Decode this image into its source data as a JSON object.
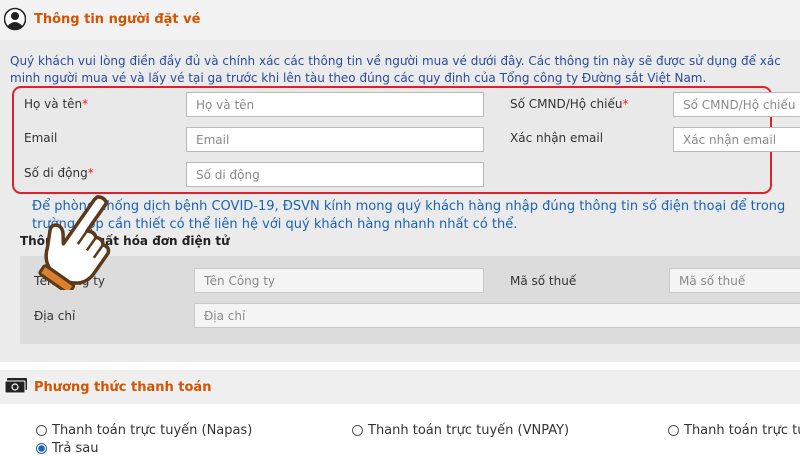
{
  "customer_section": {
    "title": "Thông tin người đặt vé",
    "intro": "Quý khách vui lòng điền đầy đủ và chính xác các thông tin về người mua vé dưới đây. Các thông tin này sẽ được sử dụng để xác minh người mua vé và lấy vé tại ga trước khi lên tàu theo đúng các quy định của Tổng công ty Đường sắt Việt Nam.",
    "fields": {
      "full_name": {
        "label": "Họ và tên",
        "required_mark": "*",
        "placeholder": "Họ và tên"
      },
      "id_number": {
        "label": "Số CMND/Hộ chiếu",
        "required_mark": "*",
        "placeholder": "Số CMND/Hộ chiếu"
      },
      "email": {
        "label": "Email",
        "placeholder": "Email"
      },
      "email_confirm": {
        "label": "Xác nhận email",
        "placeholder": "Xác nhận email"
      },
      "phone": {
        "label": "Số di động",
        "required_mark": "*",
        "placeholder": "Số di động"
      }
    },
    "covid_note": "Để phòng chống dịch bệnh COVID-19, ĐSVN kính mong quý khách hàng nhập đúng thông tin số điện thoại để trong trường hợp cần thiết có thể liên hệ với quý khách hàng nhanh nhất có thể."
  },
  "invoice_section": {
    "title": "Thông tin xuất hóa đơn điện tử",
    "company_label": "Tên Công ty",
    "company_placeholder": "Tên Công ty",
    "tax_label": "Mã số thuế",
    "tax_placeholder": "Mã số thuế",
    "address_label": "Địa chỉ",
    "address_placeholder": "Địa chỉ"
  },
  "payment_section": {
    "title": "Phương thức thanh toán",
    "options": [
      "Thanh toán trực tuyến (Napas)",
      "Thanh toán trực tuyến (VNPAY)",
      "Thanh toán trực tuyến",
      "Trả sau"
    ]
  },
  "colors": {
    "accent": "#d35400",
    "highlight_border": "#e41e2b",
    "link_blue": "#1a63b6"
  },
  "icons": [
    "user-icon",
    "pointing-hand-icon",
    "money-icon"
  ]
}
